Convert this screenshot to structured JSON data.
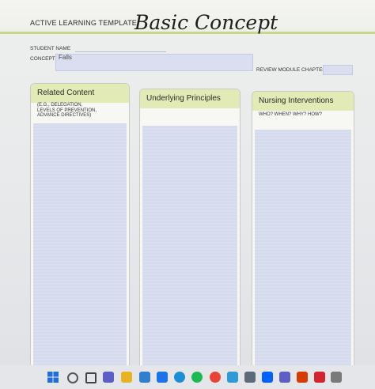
{
  "template": {
    "label": "ACTIVE LEARNING TEMPLATE:",
    "title": "Basic Concept"
  },
  "form": {
    "student_name_label": "STUDENT NAME",
    "concept_label": "CONCEPT",
    "concept_value": "Falls",
    "review_module_label": "REVIEW MODULE CHAPTER"
  },
  "columns": [
    {
      "title": "Related Content",
      "subtitle": [
        "(E.G., DELEGATION,",
        "LEVELS OF PREVENTION,",
        "ADVANCE DIRECTIVES)"
      ]
    },
    {
      "title": "Underlying Principles",
      "subtitle": []
    },
    {
      "title": "Nursing Interventions",
      "subtitle": [
        "WHO? WHEN? WHY? HOW?"
      ]
    }
  ],
  "taskbar": {
    "icons": [
      "windows-start-icon",
      "search-icon",
      "task-view-icon",
      "chat-icon",
      "file-explorer-icon",
      "store-icon",
      "mail-icon",
      "edge-icon",
      "spotify-icon",
      "chrome-icon",
      "photos-icon",
      "app-icon",
      "dropbox-icon",
      "teams-icon",
      "office-icon",
      "acrobat-icon",
      "app-icon-2"
    ],
    "colors": [
      "#1f6fd6",
      "#555555",
      "#444444",
      "#5b5fc7",
      "#e6b422",
      "#2f7fd0",
      "#1a73e8",
      "#1b8fd6",
      "#1db954",
      "#e84335",
      "#2d9bd8",
      "#5c6a7a",
      "#0061fe",
      "#5b5fc7",
      "#d83b01",
      "#d4252e",
      "#7a7a7a"
    ]
  }
}
